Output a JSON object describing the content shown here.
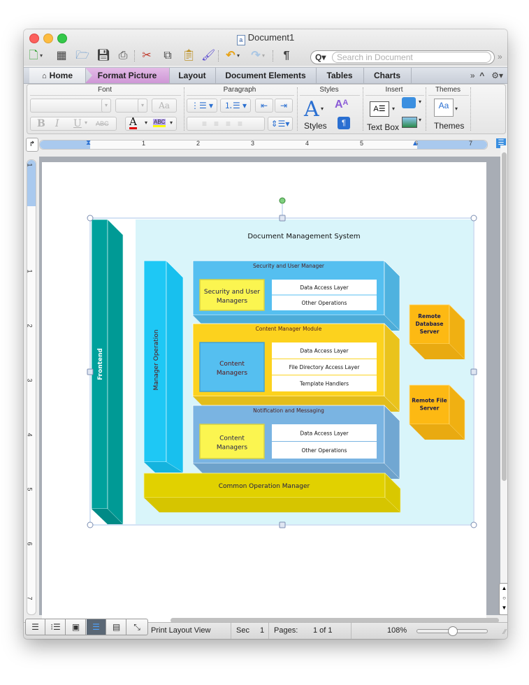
{
  "window": {
    "title": "Document1",
    "doc_icon_glyph": "a"
  },
  "toolbar": {
    "icons": [
      "new-document-icon",
      "templates-gallery-icon",
      "open-folder-icon",
      "save-icon",
      "print-icon",
      "cut-icon",
      "copy-icon",
      "paste-icon",
      "format-painter-icon",
      "undo-icon",
      "redo-icon",
      "show-formatting-icon"
    ],
    "search_placeholder": "Search in Document",
    "search_glyph": "Q▾",
    "pilcrow": "¶",
    "more": "»"
  },
  "ribbon_tabs": [
    {
      "label": "Home",
      "active": false
    },
    {
      "label": "Format Picture",
      "active": true
    },
    {
      "label": "Layout",
      "active": false
    },
    {
      "label": "Document Elements",
      "active": false
    },
    {
      "label": "Tables",
      "active": false
    },
    {
      "label": "Charts",
      "active": false
    }
  ],
  "ribbon_controls": {
    "overflow": "»",
    "collapse": "^",
    "settings": "⚙▾"
  },
  "ribbon": {
    "groups": {
      "font": "Font",
      "paragraph": "Paragraph",
      "styles": "Styles",
      "insert": "Insert",
      "themes": "Themes"
    },
    "font": {
      "font_name": "",
      "font_size": "",
      "bold": "B",
      "italic": "I",
      "underline": "U",
      "strikethrough": "ABC",
      "font_color_glyph": "A",
      "highlight_glyph": "ABC",
      "change_case": "Aa",
      "font_color": "#e00000",
      "highlight_color": "#ffff00"
    },
    "styles_label": "Styles",
    "textbox_label": "Text Box",
    "themes_label": "Themes"
  },
  "ruler": {
    "horizontal_numbers": [
      "1",
      "2",
      "3",
      "4",
      "5",
      "6",
      "7"
    ],
    "vertical_numbers": [
      "1",
      "1",
      "2",
      "3",
      "4",
      "5",
      "6",
      "7"
    ]
  },
  "statusbar": {
    "view_buttons": [
      "draft-view",
      "outline-view",
      "publishing-layout-view",
      "print-layout-view",
      "notebook-layout-view",
      "full-screen-view"
    ],
    "active_view": "print-layout-view",
    "view_name": "Print Layout View",
    "section_label": "Sec",
    "section_value": "1",
    "pages_label": "Pages:",
    "pages_value": "1 of 1",
    "zoom": "108%",
    "zoom_fraction": 0.5
  },
  "diagram": {
    "title": "Document Management System",
    "frontend": "Frontend",
    "manager_operation": "Manager Operation",
    "common_operation": "Common Operation Manager",
    "modules": [
      {
        "title": "Security and User Manager",
        "manager": "Security and User Managers",
        "layers": [
          "Data Access Layer",
          "Other Operations"
        ],
        "color": "#55bff0",
        "manager_color": "#fbf550"
      },
      {
        "title": "Content Manager Module",
        "manager": "Content Managers",
        "layers": [
          "Data Access Layer",
          "File Directory Access Layer",
          "Template Handlers"
        ],
        "color": "#fcd21e",
        "manager_color": "#55bff0"
      },
      {
        "title": "Notification and Messaging",
        "manager": "Content Managers",
        "layers": [
          "Data Access Layer",
          "Other Operations"
        ],
        "color": "#7ab4e2",
        "manager_color": "#fbf550"
      }
    ],
    "servers": [
      "Remote Database Server",
      "Remote File Server"
    ],
    "colors": {
      "background": "#d9f5fa",
      "frontend": "#00a19c",
      "manager_op": "#1ec8f5",
      "common": "#e1d100",
      "server": "#fdb913"
    }
  }
}
